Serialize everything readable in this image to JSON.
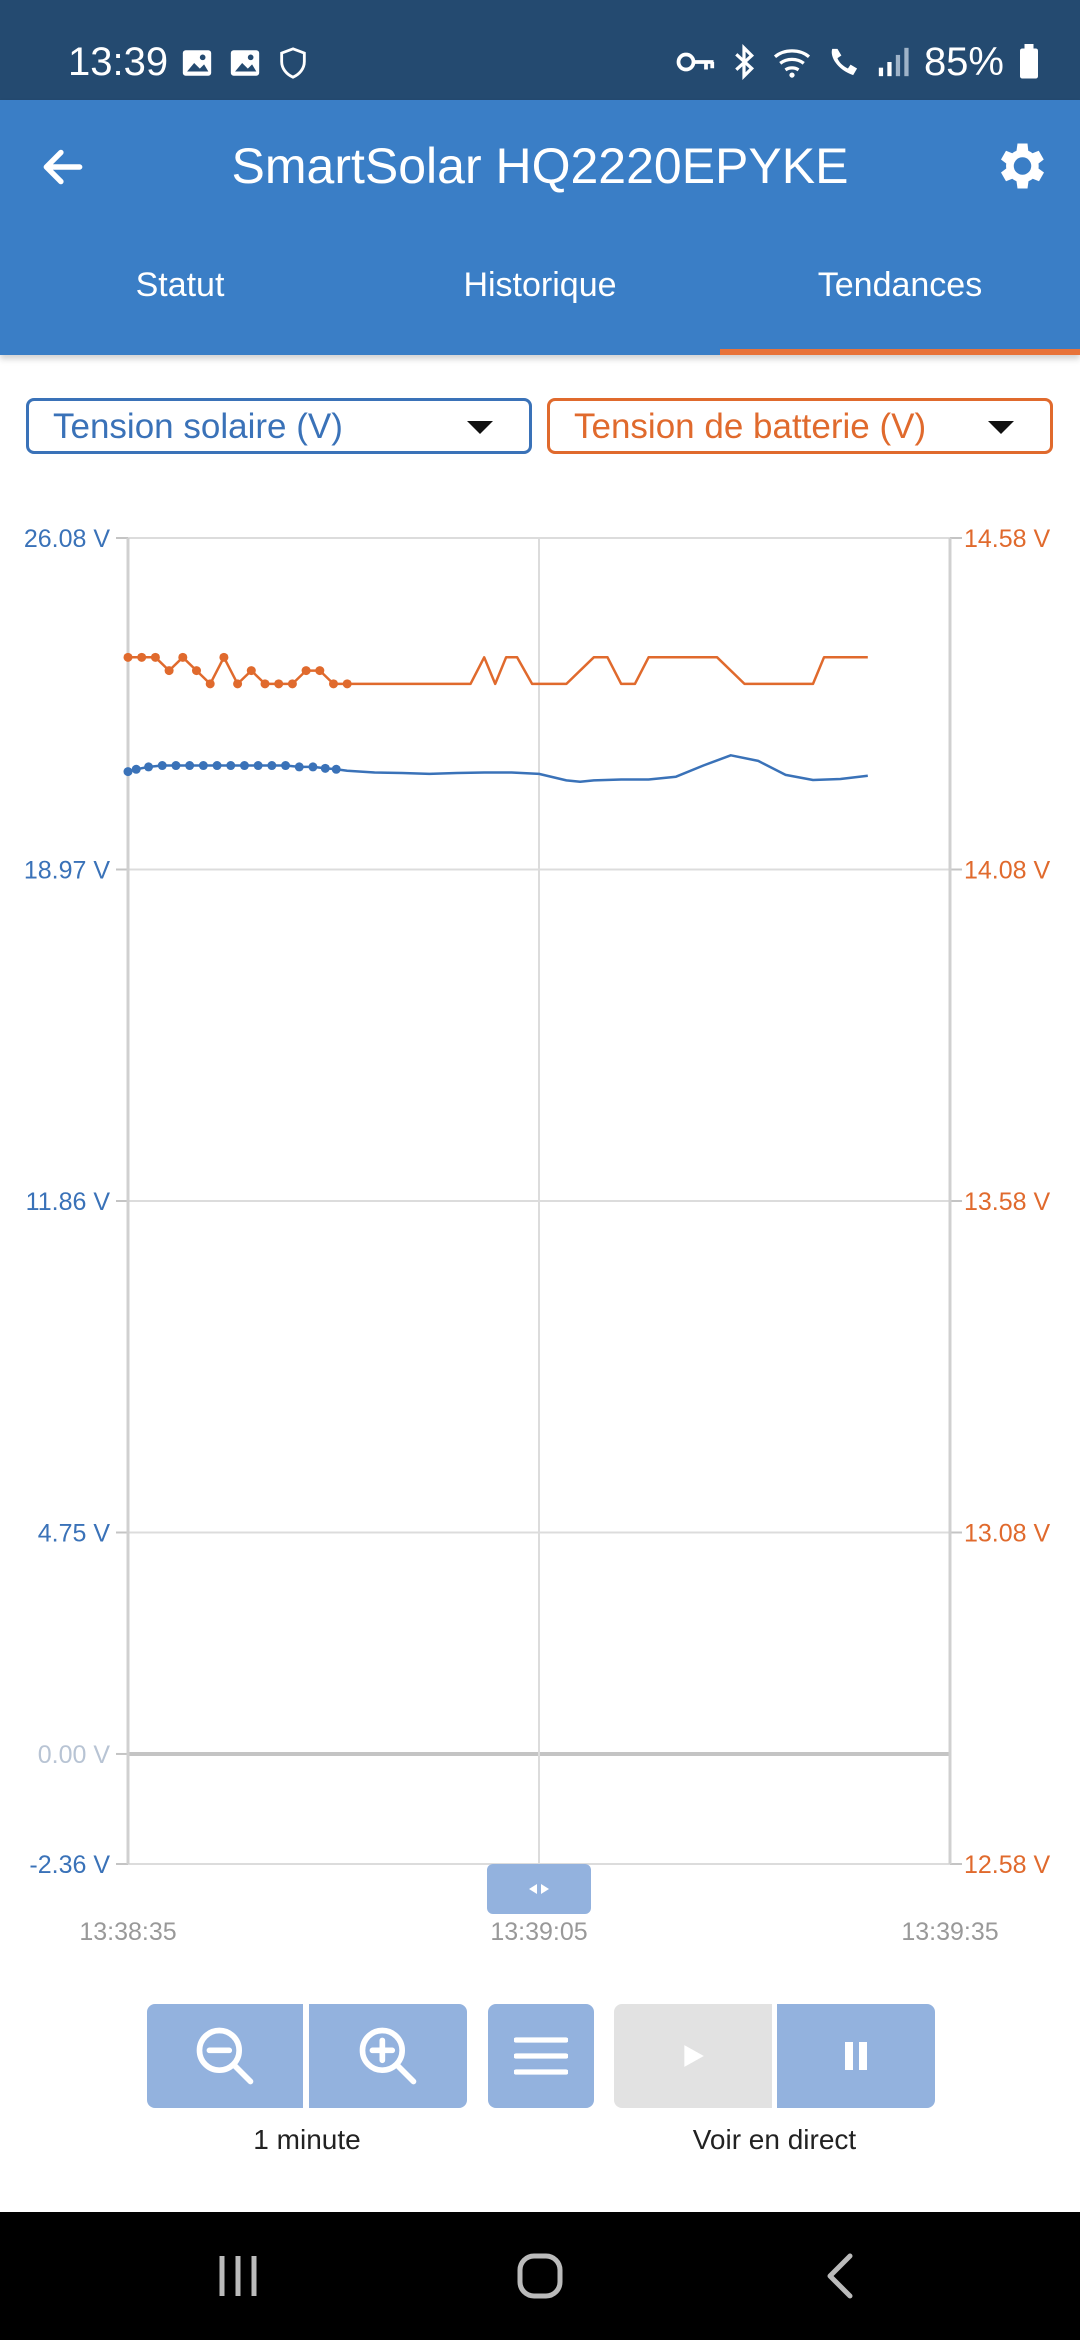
{
  "status_bar": {
    "time": "13:39",
    "battery_percent": "85%",
    "left_icons": [
      "gallery-icon",
      "gallery-icon",
      "shield-icon"
    ],
    "right_icons": [
      "key-icon",
      "bluetooth-icon",
      "wifi-icon",
      "wifi-call-icon",
      "signal-icon",
      "battery-icon"
    ]
  },
  "app_bar": {
    "title": "SmartSolar HQ2220EPYKE",
    "tabs": [
      {
        "label": "Statut",
        "active": false
      },
      {
        "label": "Historique",
        "active": false
      },
      {
        "label": "Tendances",
        "active": true
      }
    ]
  },
  "selectors": {
    "left": "Tension solaire (V)",
    "right": "Tension de batterie (V)"
  },
  "colors": {
    "solar": "#3a72b8",
    "battery": "#e06a2d",
    "app_bar": "#3a7ec6",
    "status_bar": "#244a70",
    "control": "#93b2de"
  },
  "chart_data": {
    "type": "line",
    "x_ticks": [
      "13:38:35",
      "13:39:05",
      "13:39:35"
    ],
    "left_axis_ticks": [
      "26.08 V",
      "18.97 V",
      "11.86 V",
      "4.75 V",
      "0.00 V",
      "-2.36 V"
    ],
    "right_axis_ticks": [
      "14.58 V",
      "14.08 V",
      "13.58 V",
      "13.08 V",
      "12.58 V"
    ],
    "left_axis_range": [
      -2.36,
      26.08
    ],
    "right_axis_range": [
      12.58,
      14.58
    ],
    "x_range_seconds_from_start": [
      0,
      60
    ],
    "grid": true,
    "series": [
      {
        "axis": "left",
        "color": "#3a72b8",
        "markers_until_s": 15.2,
        "x": [
          0,
          0.6,
          1.5,
          2.5,
          3.5,
          4.5,
          5.5,
          6.5,
          7.5,
          8.5,
          9.5,
          10.5,
          11.5,
          12.5,
          13.5,
          14.4,
          15.2,
          16.0,
          18.0,
          20.0,
          22.0,
          24.0,
          26.0,
          28.0,
          30.0,
          32.0,
          33.0,
          34.0,
          36.0,
          38.0,
          40.0,
          42.0,
          44.0,
          46.0,
          48.0,
          50.0,
          52.0,
          54.0
        ],
        "values": [
          21.07,
          21.12,
          21.17,
          21.2,
          21.2,
          21.2,
          21.2,
          21.2,
          21.2,
          21.2,
          21.2,
          21.2,
          21.2,
          21.17,
          21.17,
          21.14,
          21.12,
          21.09,
          21.05,
          21.04,
          21.02,
          21.04,
          21.05,
          21.05,
          21.02,
          20.88,
          20.85,
          20.88,
          20.9,
          20.9,
          20.96,
          21.2,
          21.42,
          21.3,
          21.0,
          20.89,
          20.91,
          20.98
        ]
      },
      {
        "axis": "right",
        "color": "#e06a2d",
        "markers_until_s": 16.0,
        "x": [
          0,
          1,
          2,
          3,
          4,
          5,
          6,
          7,
          8,
          9,
          10,
          11,
          12,
          13,
          14,
          15,
          16,
          25.0,
          26.0,
          26.8,
          27.6,
          28.4,
          29.5,
          30.5,
          32.0,
          34.0,
          35.0,
          36.0,
          37.0,
          38.0,
          39.0,
          41.0,
          43.0,
          45.0,
          46.5,
          48.0,
          50.0,
          50.8,
          52.0,
          54.0
        ],
        "values": [
          14.4,
          14.4,
          14.4,
          14.38,
          14.4,
          14.38,
          14.36,
          14.4,
          14.36,
          14.38,
          14.36,
          14.36,
          14.36,
          14.38,
          14.38,
          14.36,
          14.36,
          14.36,
          14.4,
          14.36,
          14.4,
          14.4,
          14.36,
          14.36,
          14.36,
          14.4,
          14.4,
          14.36,
          14.36,
          14.4,
          14.4,
          14.4,
          14.4,
          14.36,
          14.36,
          14.36,
          14.36,
          14.4,
          14.4,
          14.4
        ]
      }
    ]
  },
  "controls": {
    "zoom_label": "1 minute",
    "live_label": "Voir en direct",
    "buttons": [
      "zoom-out-icon",
      "zoom-in-icon",
      "menu-icon",
      "play-icon",
      "pause-icon"
    ]
  },
  "nav_bar": {
    "buttons": [
      "recents-icon",
      "home-icon",
      "back-icon"
    ]
  }
}
